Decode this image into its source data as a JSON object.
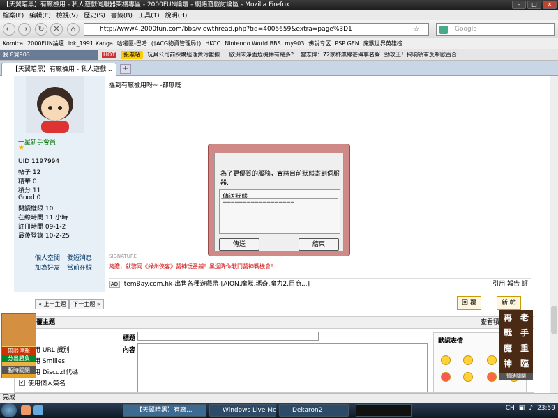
{
  "window": {
    "title": "【天翼暗黑】有廠檢用 - 私人遊戲伺服器架構專區 - 2000FUN論壇 - 網絡遊戲討論區 - Mozilla Firefox",
    "min": "–",
    "max": "□",
    "close": "✕"
  },
  "menu": [
    "檔案(F)",
    "編輯(E)",
    "檢視(V)",
    "歷史(S)",
    "書籤(B)",
    "工具(T)",
    "說明(H)"
  ],
  "nav": {
    "url": "http://www4.2000fun.com/bbs/viewthread.php?tid=4005659&extra=page%3D1",
    "search_placeholder": "Google"
  },
  "bookmarks": [
    "Komica",
    "2000FUN論壇",
    "lok_1991 Xanga",
    "哈啦區-巴哈",
    "(†ACG物資管理局†)",
    "HKCC",
    "Nintendo World BBS",
    "my903",
    "佛說专区",
    "PSP GEN",
    "魔獸世界英雄榜"
  ],
  "toolbar2": {
    "left": "我.8寶903",
    "hot": "HOT",
    "tag": "投票站",
    "news": [
      "玩具公司前採購經理貪污證據...",
      "歐洲未淨面危機仲有幾多？",
      "曾志偉：72家杯無線甚攝事名聲",
      "勁攻王！揭晌領軍反擊歐百合..."
    ]
  },
  "tab": {
    "label": "【天翼暗黑】有廠檢用 - 私人遊戲...",
    "new": "+"
  },
  "post": {
    "text": "搵到有廠檢用呀~ -都無既",
    "rank": "一星新手會員",
    "stats": [
      [
        "UID",
        "1197994"
      ],
      [
        "帖子",
        "12"
      ],
      [
        "精華",
        "0"
      ],
      [
        "積分",
        "11"
      ],
      [
        "Good",
        "0"
      ],
      [
        "閱讀權限",
        "10"
      ],
      [
        "在線時間",
        "11 小時"
      ],
      [
        "註冊時間",
        "09-1-2"
      ],
      [
        "最後登錄",
        "10-2-25"
      ]
    ],
    "links": [
      "個人空間",
      "發短消息",
      "加為好友",
      "當前在線"
    ],
    "signature_tag": "SIGNATURE",
    "signature": "夠膽，就黎同《綠州俠客》醬神玩番鋪！黑迴降你戰鬥醬神戰機會！",
    "ad": "ItemBay.com.hk-出售各種遊戲幣-[AION,魔獸,瑪奇,魔力2,巨商...]",
    "actions": "引用 報告 評"
  },
  "pager": {
    "prev": "« 上一主題",
    "next": "下一主題 »"
  },
  "buttons": {
    "reply": "回 覆",
    "newpost": "新 帖"
  },
  "quick": {
    "title": "快速回覆主題",
    "policy": "查看積分策略說明",
    "options_label": "選項",
    "subject_label": "標題",
    "content_label": "內容",
    "options": [
      "禁用 URL 識別",
      "禁用 Smilies",
      "禁用 Discuz!代碼",
      "使用個人簽名"
    ],
    "emoticons_label": "默認表情"
  },
  "ads": {
    "left_top": "無限連擊",
    "left_mid": "分出勝負",
    "left_close": "暫時關閉",
    "right_lines": [
      "再",
      "老",
      "戰",
      "手",
      "魔",
      "重",
      "神",
      "臨"
    ],
    "right_close": "暫時關閉"
  },
  "dialog": {
    "message": "為了更優質的服務，會將目前狀態寄到伺服器.",
    "box_label": "傳送狀態",
    "progress": "==================",
    "send": "傳送",
    "end": "結束"
  },
  "status": "完成",
  "taskbar": {
    "tasks": [
      "【天翼暗黑】有廠...",
      "Windows Live Mes...",
      "Dekaron2"
    ],
    "lang": "CH",
    "time": "23:59"
  }
}
